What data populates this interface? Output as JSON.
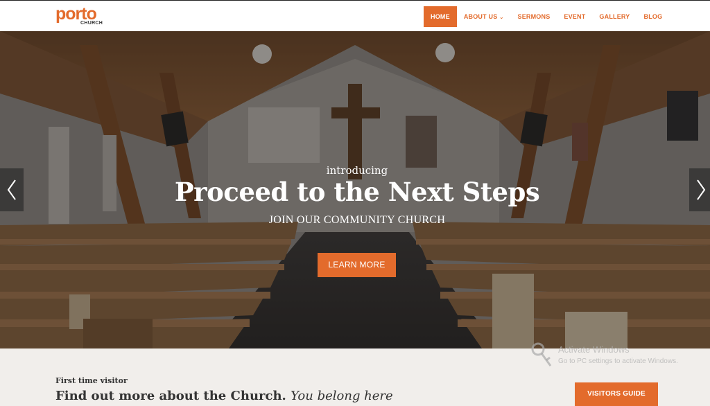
{
  "brand": {
    "logo_main": "porto",
    "logo_sub": "CHURCH",
    "accent_color": "#e36b2c"
  },
  "nav": {
    "items": [
      {
        "label": "HOME",
        "active": true
      },
      {
        "label": "ABOUT US",
        "has_dropdown": true,
        "dropdown_icon": "chevron-down-icon"
      },
      {
        "label": "SERMONS"
      },
      {
        "label": "EVENT"
      },
      {
        "label": "GALLERY"
      },
      {
        "label": "BLOG"
      }
    ]
  },
  "hero": {
    "intro": "introducing",
    "title": "Proceed to the Next Steps",
    "subtitle": "JOIN OUR COMMUNITY CHURCH",
    "button_label": "LEARN MORE",
    "prev_icon": "chevron-left-icon",
    "next_icon": "chevron-right-icon"
  },
  "visitor": {
    "kicker": "First time visitor",
    "heading": "Find out more about the Church.",
    "heading_em": "You belong here",
    "button_label": "VISITORS GUIDE"
  },
  "watermark": {
    "line1": "Activate Windows",
    "line2": "Go to PC settings to activate Windows."
  }
}
